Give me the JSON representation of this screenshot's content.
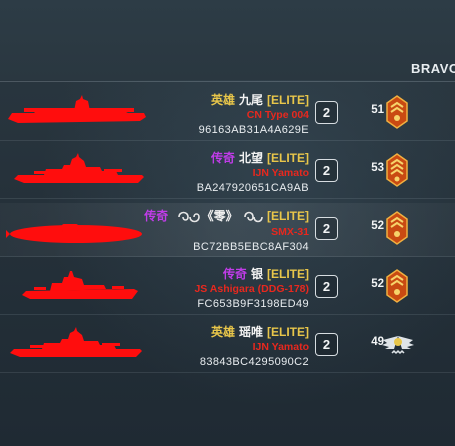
{
  "team": {
    "label": "BRAVO"
  },
  "colors": {
    "hull": "#ff0d0d",
    "legendary": "#c03ce8",
    "hero": "#e8c64a",
    "ship_name": "#e8281e",
    "elite": "#e8c64a"
  },
  "players": [
    {
      "tier": "英雄",
      "tier_color": "#e8c64a",
      "name": "九尾",
      "tag": "[ELITE]",
      "ship": "CN Type 004",
      "id": "96163AB31A4A629E",
      "slot": "2",
      "level": "51",
      "rank_icon": "chevron-rank-icon",
      "silhouette": "carrier"
    },
    {
      "tier": "传奇",
      "tier_color": "#c03ce8",
      "name": "北望",
      "tag": "[ELITE]",
      "ship": "IJN Yamato",
      "id": "BA247920651CA9AB",
      "slot": "2",
      "level": "53",
      "rank_icon": "chevron-rank-icon",
      "silhouette": "battleship"
    },
    {
      "tier": "传奇",
      "tier_color": "#c03ce8",
      "name": "《零》",
      "tag": "[ELITE]",
      "ship": "SMX-31",
      "id": "BC72BB5EBC8AF304",
      "slot": "2",
      "level": "52",
      "rank_icon": "chevron-rank-icon",
      "silhouette": "submarine"
    },
    {
      "tier": "传奇",
      "tier_color": "#c03ce8",
      "name": "银",
      "tag": "[ELITE]",
      "ship": "JS Ashigara (DDG-178)",
      "id": "FC653B9F3198ED49",
      "slot": "2",
      "level": "52",
      "rank_icon": "chevron-rank-icon",
      "silhouette": "destroyer"
    },
    {
      "tier": "英雄",
      "tier_color": "#e8c64a",
      "name": "瑶唯",
      "tag": "[ELITE]",
      "ship": "IJN Yamato",
      "id": "83843BC4295090C2",
      "slot": "2",
      "level": "49",
      "rank_icon": "wings-rank-icon",
      "silhouette": "battleship"
    }
  ]
}
